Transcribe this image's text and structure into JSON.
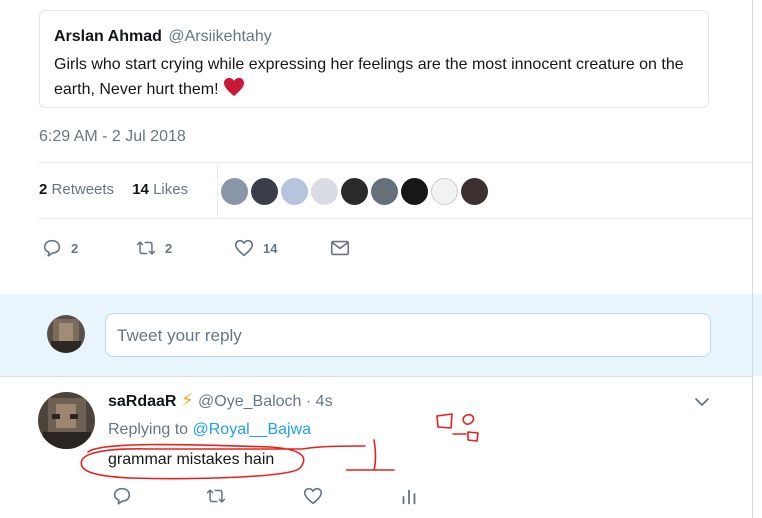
{
  "quoted_tweet": {
    "author_name": "Arslan Ahmad",
    "author_handle": "@Arsiikehtahy",
    "text": "Girls who start crying while expressing her feelings are the most innocent creature on the earth, Never hurt them!",
    "emoji_icon": "red-heart-icon"
  },
  "timestamp": "6:29 AM - 2 Jul 2018",
  "stats": {
    "retweets_count": "2",
    "retweets_label": "Retweets",
    "likes_count": "14",
    "likes_label": "Likes"
  },
  "actions": {
    "reply_count": "2",
    "retweet_count": "2",
    "like_count": "14"
  },
  "reply_box": {
    "placeholder": "Tweet your reply"
  },
  "reply_tweet": {
    "author_name": "saRdaaR",
    "emoji": "⚡",
    "author_handle": "@Oye_Baloch",
    "time": "· 4s",
    "replying_prefix": "Replying to",
    "replying_to": "@Royal__Bajwa",
    "text": "grammar mistakes hain"
  },
  "colors": {
    "accent": "#1da1f2",
    "muted_text": "#657786",
    "heart": "#e0245e",
    "annotation": "#e8201f"
  }
}
